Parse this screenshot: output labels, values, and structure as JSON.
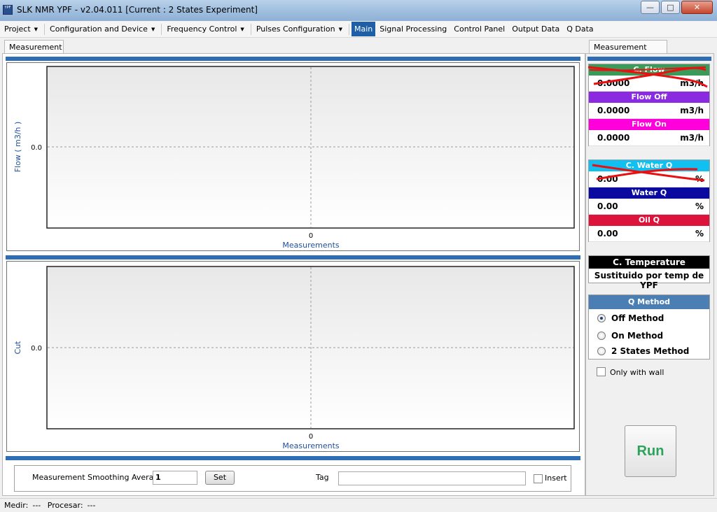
{
  "window": {
    "app_icon_text": "YPF",
    "title": "SLK NMR YPF - v2.04.011 [Current : 2 States Experiment]",
    "minimize_glyph": "—",
    "maximize_glyph": "□",
    "close_glyph": "✕"
  },
  "menu": [
    {
      "label": "Project",
      "dropdown": true
    },
    {
      "label": "Configuration and Device",
      "dropdown": true
    },
    {
      "label": "Frequency Control",
      "dropdown": true
    },
    {
      "label": "Pulses Configuration",
      "dropdown": true
    },
    {
      "label": "Main",
      "dropdown": false,
      "active": true
    },
    {
      "label": "Signal Processing",
      "dropdown": false
    },
    {
      "label": "Control Panel",
      "dropdown": false
    },
    {
      "label": "Output Data",
      "dropdown": false
    },
    {
      "label": "Q Data",
      "dropdown": false
    }
  ],
  "tabs": {
    "left": "Measurement",
    "right": "Measurement Data"
  },
  "charts": {
    "top": {
      "ylabel": "Flow  ( m3/h )",
      "ytick": "0.0",
      "xtick": "0",
      "xlabel": "Measurements"
    },
    "bottom": {
      "ylabel": "Cut",
      "ytick": "0.0",
      "xtick": "0",
      "xlabel": "Measurements"
    }
  },
  "controls": {
    "smoothing_label": "Measurement Smoothing Average",
    "smoothing_value": "1",
    "set_label": "Set",
    "tag_label": "Tag",
    "tag_value": "",
    "insert_label": "Insert"
  },
  "status": {
    "medir_label": "Medir:",
    "medir_value": "---",
    "procesar_label": "Procesar:",
    "procesar_value": "---"
  },
  "measurement_data": {
    "flow": [
      {
        "label": "C. Flow",
        "value": "0.0000",
        "unit": "m3/h",
        "color": "#3a9a5a"
      },
      {
        "label": "Flow Off",
        "value": "0.0000",
        "unit": "m3/h",
        "color": "#8a2be2"
      },
      {
        "label": "Flow On",
        "value": "0.0000",
        "unit": "m3/h",
        "color": "#ff00dc"
      }
    ],
    "water": [
      {
        "label": "C. Water Q",
        "value": "0.00",
        "unit": "%",
        "color": "#10c0f0"
      },
      {
        "label": "Water Q",
        "value": "0.00",
        "unit": "%",
        "color": "#0a0aa0"
      },
      {
        "label": "Oil Q",
        "value": "0.00",
        "unit": "%",
        "color": "#dc143c"
      }
    ],
    "temperature": {
      "label": "C. Temperature",
      "value": "Sustituido por temp de YPF"
    },
    "q_method": {
      "label": "Q Method",
      "options": [
        "Off Method",
        "On Method",
        "2 States Method"
      ],
      "selected": "Off Method"
    },
    "only_with_wall": "Only with wall"
  },
  "run_label": "Run"
}
